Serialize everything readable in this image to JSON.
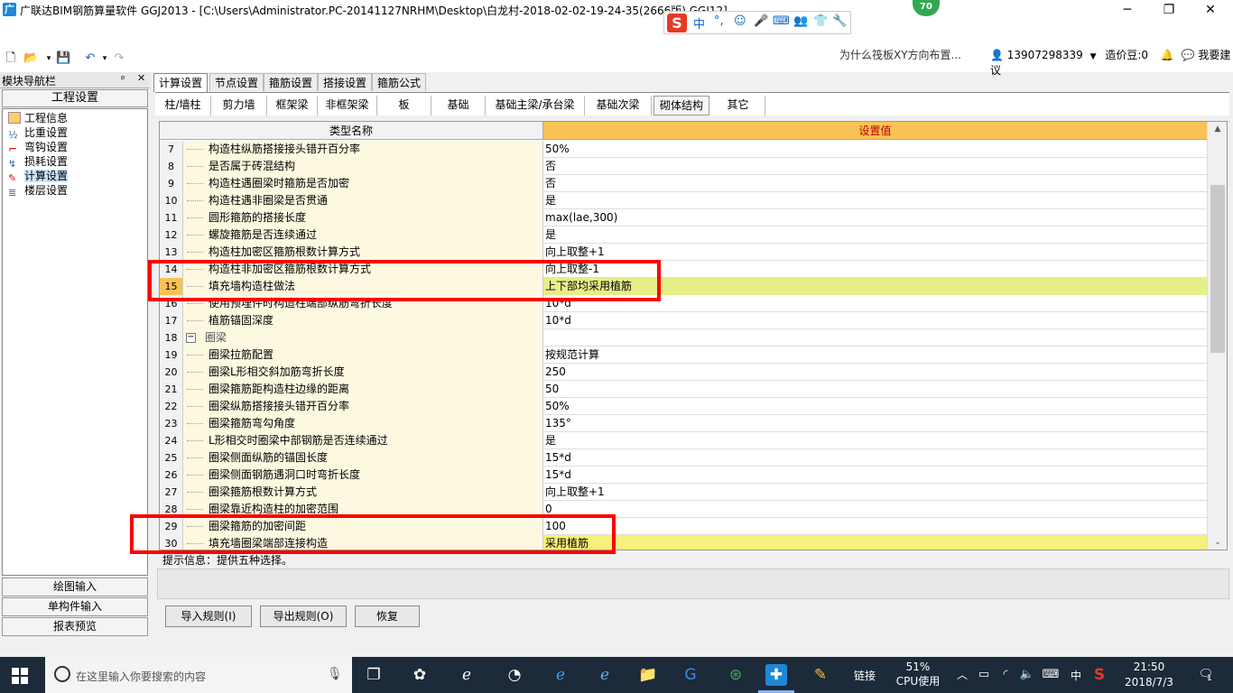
{
  "window": {
    "title": "广联达BIM钢筋算量软件 GGJ2013 - [C:\\Users\\Administrator.PC-20141127NRHM\\Desktop\\白龙村-2018-02-02-19-24-35(2666版).GGJ12]",
    "minimize": "─",
    "maximize": "❐",
    "close": "✕"
  },
  "overlay": {
    "badge": "70",
    "ime_logo": "S",
    "ime_lang": "中",
    "ad_text": "为什么筏板XY方向布置...",
    "phone": "13907298339",
    "coins_label": "造价豆:0",
    "feedback": "我要建议"
  },
  "sidebar": {
    "header": "模块导航栏",
    "pin": "ᵖ",
    "close": "✕",
    "section": "工程设置",
    "items": [
      {
        "label": "工程信息",
        "icon": "info-icon"
      },
      {
        "label": "比重设置",
        "icon": "weight-icon"
      },
      {
        "label": "弯钩设置",
        "icon": "hook-icon"
      },
      {
        "label": "损耗设置",
        "icon": "loss-icon"
      },
      {
        "label": "计算设置",
        "icon": "calc-icon",
        "selected": true
      },
      {
        "label": "楼层设置",
        "icon": "floor-icon"
      }
    ],
    "bottom_buttons": [
      "绘图输入",
      "单构件输入",
      "报表预览"
    ]
  },
  "tabs_primary": [
    "计算设置",
    "节点设置",
    "箍筋设置",
    "搭接设置",
    "箍筋公式"
  ],
  "tabs_secondary": [
    "柱/墙柱",
    "剪力墙",
    "框架梁",
    "非框架梁",
    "板",
    "基础",
    "基础主梁/承台梁",
    "基础次梁",
    "砌体结构",
    "其它"
  ],
  "grid": {
    "col_name": "类型名称",
    "col_value": "设置值",
    "rows": [
      {
        "no": "7",
        "name": "构造柱纵筋搭接接头错开百分率",
        "value": "50%"
      },
      {
        "no": "8",
        "name": "是否属于砖混结构",
        "value": "否"
      },
      {
        "no": "9",
        "name": "构造柱遇圈梁时箍筋是否加密",
        "value": "否"
      },
      {
        "no": "10",
        "name": "构造柱遇非圈梁是否贯通",
        "value": "是"
      },
      {
        "no": "11",
        "name": "圆形箍筋的搭接长度",
        "value": "max(lae,300)"
      },
      {
        "no": "12",
        "name": "螺旋箍筋是否连续通过",
        "value": "是"
      },
      {
        "no": "13",
        "name": "构造柱加密区箍筋根数计算方式",
        "value": "向上取整+1"
      },
      {
        "no": "14",
        "name": "构造柱非加密区箍筋根数计算方式",
        "value": "向上取整-1"
      },
      {
        "no": "15",
        "name": "填充墙构造柱做法",
        "value": "上下部均采用植筋",
        "highlight": "green"
      },
      {
        "no": "16",
        "name": "使用预埋件时构造柱端部纵筋弯折长度",
        "value": "10*d"
      },
      {
        "no": "17",
        "name": "植筋锚固深度",
        "value": "10*d"
      },
      {
        "no": "18",
        "name": "圈梁",
        "value": "",
        "group": true
      },
      {
        "no": "19",
        "name": "圈梁拉筋配置",
        "value": "按规范计算"
      },
      {
        "no": "20",
        "name": "圈梁L形相交斜加筋弯折长度",
        "value": "250"
      },
      {
        "no": "21",
        "name": "圈梁箍筋距构造柱边缘的距离",
        "value": "50"
      },
      {
        "no": "22",
        "name": "圈梁纵筋搭接接头错开百分率",
        "value": "50%"
      },
      {
        "no": "23",
        "name": "圈梁箍筋弯勾角度",
        "value": "135°"
      },
      {
        "no": "24",
        "name": "L形相交时圈梁中部钢筋是否连续通过",
        "value": "是"
      },
      {
        "no": "25",
        "name": "圈梁侧面纵筋的锚固长度",
        "value": "15*d"
      },
      {
        "no": "26",
        "name": "圈梁侧面钢筋遇洞口时弯折长度",
        "value": "15*d"
      },
      {
        "no": "27",
        "name": "圈梁箍筋根数计算方式",
        "value": "向上取整+1"
      },
      {
        "no": "28",
        "name": "圈梁靠近构造柱的加密范围",
        "value": "0"
      },
      {
        "no": "29",
        "name": "圈梁箍筋的加密间距",
        "value": "100"
      },
      {
        "no": "30",
        "name": "填充墙圈梁端部连接构造",
        "value": "采用植筋",
        "highlight": "yellow"
      }
    ]
  },
  "hint": "提示信息：提供五种选择。",
  "buttons": {
    "import": "导入规则(I)",
    "export": "导出规则(O)",
    "restore": "恢复"
  },
  "taskbar": {
    "search_placeholder": "在这里输入你要搜索的内容",
    "link": "链接",
    "cpu_pct": "51%",
    "cpu_label": "CPU使用",
    "ime": "中",
    "time": "21:50",
    "date": "2018/7/3",
    "notif": "1"
  },
  "colors": {
    "header_value": "#f9c255",
    "highlight_green": "#e6ee88",
    "highlight_yellow": "#f7f07c",
    "red_box": "#ff0000",
    "taskbar": "#1c2a3a"
  }
}
